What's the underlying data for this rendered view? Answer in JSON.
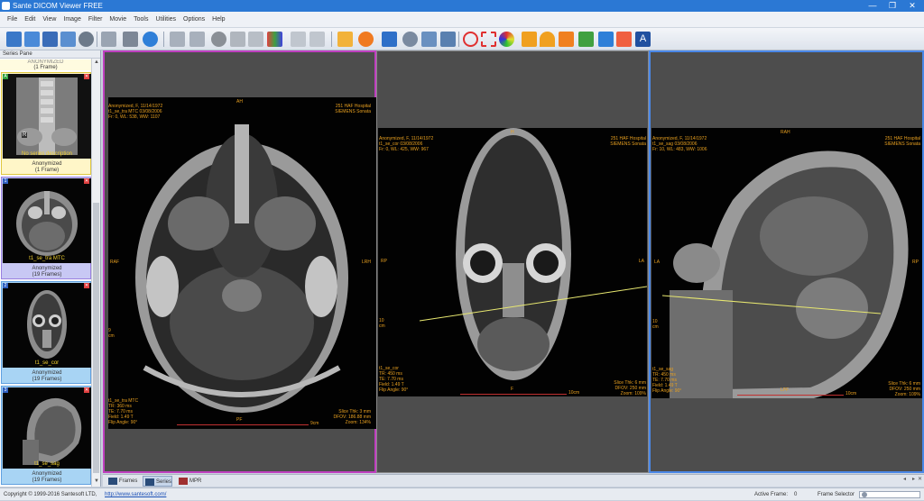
{
  "window": {
    "title": "Sante DICOM Viewer FREE"
  },
  "menu": [
    "File",
    "Edit",
    "View",
    "Image",
    "Filter",
    "Movie",
    "Tools",
    "Utilities",
    "Options",
    "Help"
  ],
  "series_pane": {
    "header": "Series Pane",
    "top_caption": "(1 Frame)",
    "items": [
      {
        "badge": "A",
        "label": "No series description",
        "patient": "Anonymized",
        "frames": "(1 Frame)",
        "marker": "R"
      },
      {
        "badge": "1",
        "label": "t1_se_tra MTC",
        "patient": "Anonymized",
        "frames": "(19 Frames)"
      },
      {
        "badge": "2",
        "label": "t1_se_cor",
        "patient": "Anonymized",
        "frames": "(19 Frames)"
      },
      {
        "badge": "3",
        "label": "t1_se_sag",
        "patient": "Anonymized",
        "frames": "(19 Frames)"
      }
    ]
  },
  "viewports": [
    {
      "tl": "Anonymized, F, 11/14/1972\nt1_se_tra MTC 03/08/2006\nFr: 0, WL: 538, WW: 1107",
      "tr": "251 HAF Hospital\nSIEMENS Sonata",
      "bl": "t1_se_tra MTC\nTR: 360 ms\nTE: 7.70 ms\nField: 1.49 T\nFlip Angle: 90°",
      "br": "Slice Thk: 3 mm\nDFOV: 186.88 mm\nZoom: 134%",
      "top": "AH",
      "left": "RAF",
      "right": "LRH",
      "bottom": "PF",
      "scale": "9cm",
      "ruler": "9\ncm"
    },
    {
      "tl": "Anonymized, F, 11/14/1972\nt1_se_cor 03/08/2006\nFr: 0, WL: 425, WW: 967",
      "tr": "251 HAF Hospital\nSIEMENS Sonata",
      "bl": "t1_se_cor\nTR: 450 ms\nTE: 7.70 ms\nField: 1.49 T\nFlip Angle: 90°",
      "br": "Slice Thk: 6 mm\nDFOV: 250 mm\nZoom: 109%",
      "top": "H",
      "left": "RP",
      "right": "LA",
      "bottom": "F",
      "scale": "10cm",
      "ruler": "10\ncm"
    },
    {
      "tl": "Anonymized, F, 11/14/1972\nt1_se_sag 03/08/2006\nFr: 10, WL: 483, WW: 1006",
      "tr": "251 HAF Hospital\nSIEMENS Sonata",
      "bl": "t1_se_sag\nTR: 450 ms\nTE: 7.70 ms\nField: 1.49 T\nFlip Angle: 90°",
      "br": "Slice Thk: 6 mm\nDFOV: 250 mm\nZoom: 109%",
      "top": "RAH",
      "left": "LA",
      "right": "RP",
      "bottom": "LPF",
      "scale": "10cm",
      "ruler": "10\ncm"
    }
  ],
  "tabs": [
    "Frames",
    "Series",
    "MPR"
  ],
  "status": {
    "copyright": "Copyright © 1999-2016 Santesoft LTD,",
    "url": "http://www.santesoft.com/",
    "active_frame_label": "Active Frame:",
    "active_frame_value": "0",
    "frame_selector_label": "Frame Selector"
  },
  "colors": {
    "titlebar": "#2b78d4",
    "overlay_text": "#e8a020",
    "vp1_border": "#c040c0",
    "vp2_border": "#c040c0",
    "vp3_border": "#4a88e8",
    "reference_line": "#e8e870"
  }
}
